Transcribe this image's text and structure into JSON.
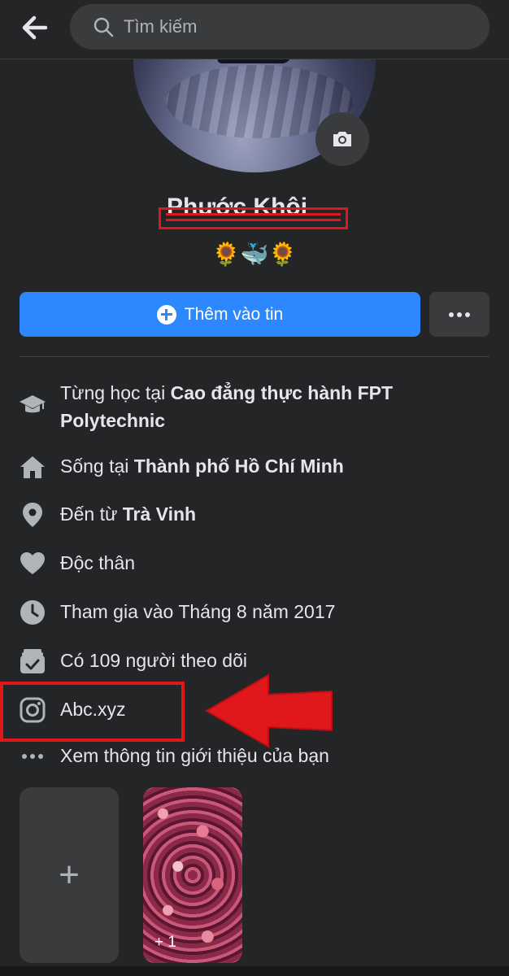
{
  "search": {
    "placeholder": "Tìm kiếm"
  },
  "profile": {
    "name_redacted": "Phước Khôi",
    "bio": "🌻🐳🌻"
  },
  "actions": {
    "add_story_label": "Thêm vào tin",
    "more_label": "..."
  },
  "details": [
    {
      "icon": "graduation-cap-icon",
      "prefix": "Từng học tại ",
      "bold": "Cao đẳng thực hành FPT Polytechnic"
    },
    {
      "icon": "home-icon",
      "prefix": "Sống tại ",
      "bold": "Thành phố Hồ Chí Minh"
    },
    {
      "icon": "location-pin-icon",
      "prefix": "Đến từ ",
      "bold": "Trà Vinh"
    },
    {
      "icon": "heart-icon",
      "prefix": "Độc thân",
      "bold": ""
    },
    {
      "icon": "clock-icon",
      "prefix": "Tham gia vào Tháng 8 năm 2017",
      "bold": ""
    },
    {
      "icon": "followers-icon",
      "prefix": "Có 109 người theo dõi",
      "bold": ""
    },
    {
      "icon": "instagram-icon",
      "prefix": "Abc.xyz",
      "bold": ""
    },
    {
      "icon": "more-dots-icon",
      "prefix": "Xem thông tin giới thiệu của bạn",
      "bold": ""
    }
  ],
  "highlights": {
    "add_symbol": "+",
    "photo_count": "+ 1"
  },
  "colors": {
    "background": "#242526",
    "primary_button": "#2d88ff",
    "annotation_red": "#e0181c"
  }
}
